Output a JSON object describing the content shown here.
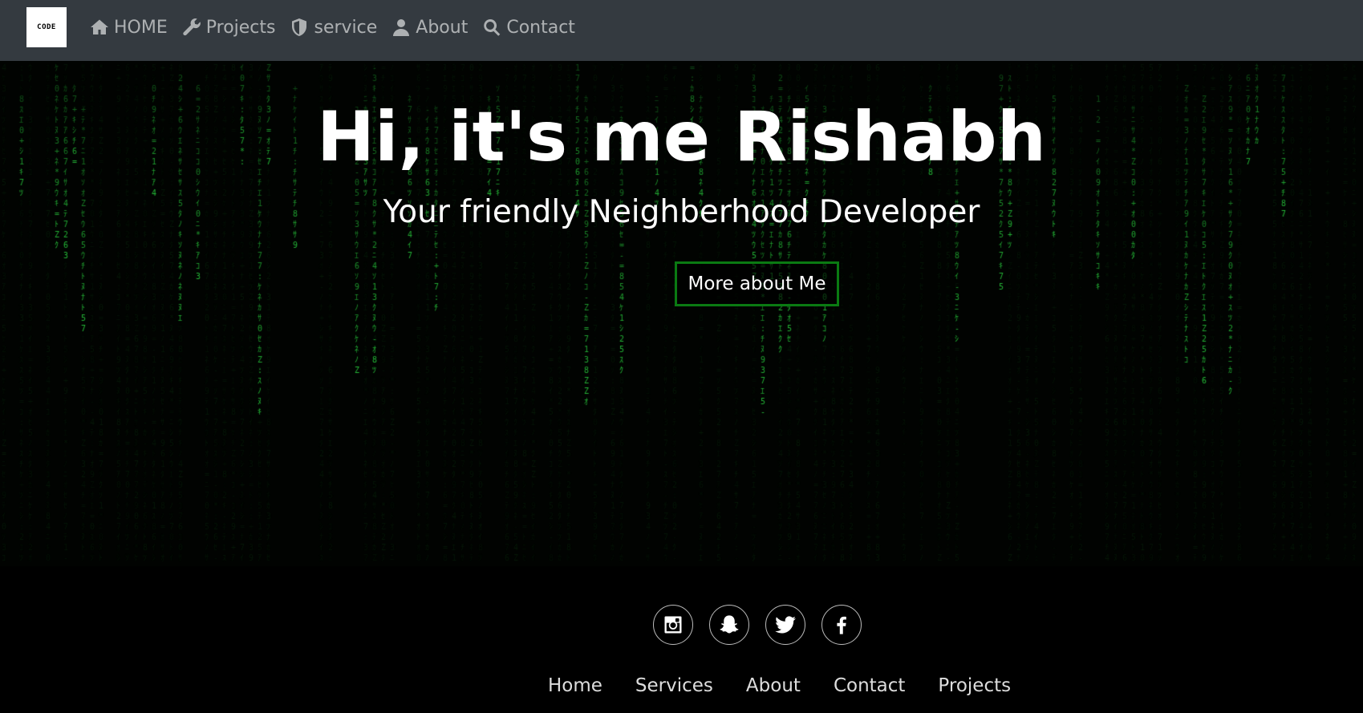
{
  "navbar": {
    "logo_text": "CODE",
    "items": [
      {
        "label": "HOME",
        "icon": "home-icon"
      },
      {
        "label": "Projects",
        "icon": "wrench-icon"
      },
      {
        "label": "service",
        "icon": "shield-icon"
      },
      {
        "label": "About",
        "icon": "user-icon"
      },
      {
        "label": "Contact",
        "icon": "search-icon"
      }
    ]
  },
  "hero": {
    "title": "Hi, it's me Rishabh",
    "subtitle": "Your friendly Neighberhood Developer",
    "button_label": "More about Me",
    "background": "matrix-code-rain",
    "accent_color": "#0a7a12",
    "rain_color": "#1fb83a"
  },
  "footer": {
    "socials": [
      {
        "icon": "instagram-icon"
      },
      {
        "icon": "snapchat-icon"
      },
      {
        "icon": "twitter-icon"
      },
      {
        "icon": "facebook-icon"
      }
    ],
    "links": [
      "Home",
      "Services",
      "About",
      "Contact",
      "Projects"
    ]
  },
  "colors": {
    "navbar_bg": "#343a40",
    "nav_text": "rgba(255,255,255,0.6)",
    "page_bg": "#000000"
  }
}
